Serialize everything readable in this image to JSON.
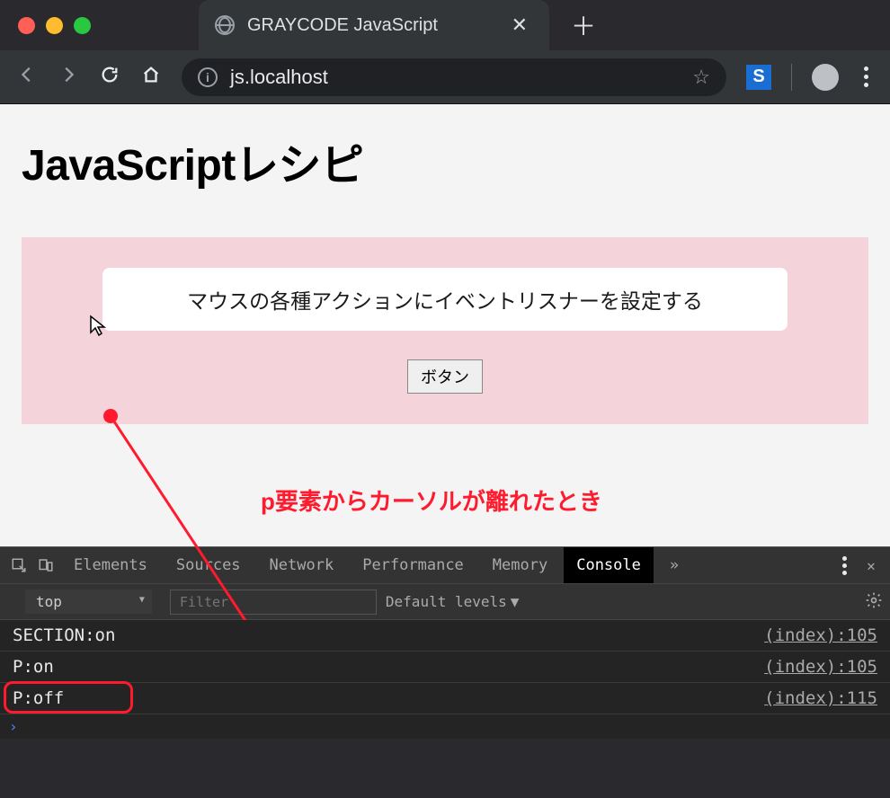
{
  "window": {
    "tab_title": "GRAYCODE JavaScript"
  },
  "toolbar": {
    "url": "js.localhost"
  },
  "page": {
    "heading": "JavaScriptレシピ",
    "paragraph": "マウスの各種アクションにイベントリスナーを設定する",
    "button_label": "ボタン",
    "annotation": "p要素からカーソルが離れたとき"
  },
  "devtools": {
    "tabs": [
      "Elements",
      "Sources",
      "Network",
      "Performance",
      "Memory",
      "Console"
    ],
    "active_tab": "Console",
    "context": "top",
    "filter_placeholder": "Filter",
    "levels_label": "Default levels",
    "console": [
      {
        "msg": "SECTION:on",
        "src": "(index):105"
      },
      {
        "msg": "P:on",
        "src": "(index):105"
      },
      {
        "msg": "P:off",
        "src": "(index):115"
      }
    ]
  }
}
